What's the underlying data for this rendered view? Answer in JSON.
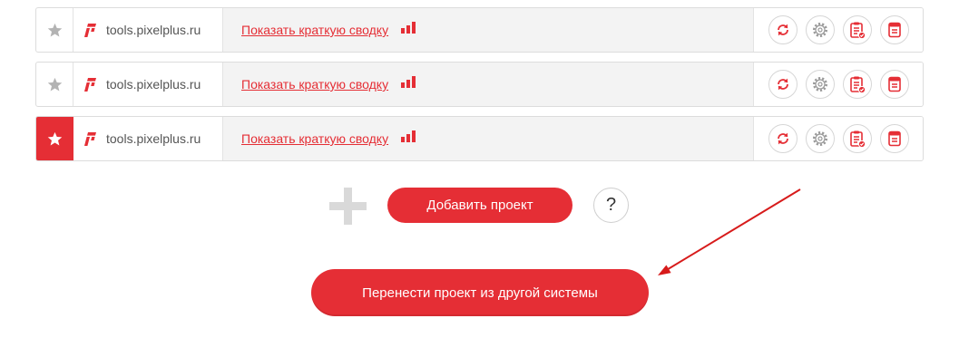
{
  "projects": [
    {
      "domain": "tools.pixelplus.ru",
      "summary_link": "Показать краткую сводку",
      "favorite": false
    },
    {
      "domain": "tools.pixelplus.ru",
      "summary_link": "Показать краткую сводку",
      "favorite": false
    },
    {
      "domain": "tools.pixelplus.ru",
      "summary_link": "Показать краткую сводку",
      "favorite": true
    }
  ],
  "row_icons": {
    "favorite": "star-icon",
    "logo": "pixelplus-logo-icon",
    "summary": "bar-chart-icon",
    "actions": [
      "refresh-icon",
      "settings-icon",
      "report-icon",
      "print-icon"
    ]
  },
  "add_project": {
    "label": "Добавить проект",
    "icon": "plus-icon"
  },
  "help_button": {
    "label": "?"
  },
  "transfer_button": {
    "label": "Перенести проект из другой системы"
  },
  "annotation": {
    "icon": "red-arrow-icon"
  },
  "colors": {
    "accent": "#e52e35",
    "star_inactive": "#b3b3b3",
    "summary_bg": "#f3f3f3",
    "border": "#dcdcdc",
    "text": "#555555",
    "plus": "#d9d9d9",
    "gear": "#9a9a9a",
    "arrow": "#d71b1b"
  }
}
